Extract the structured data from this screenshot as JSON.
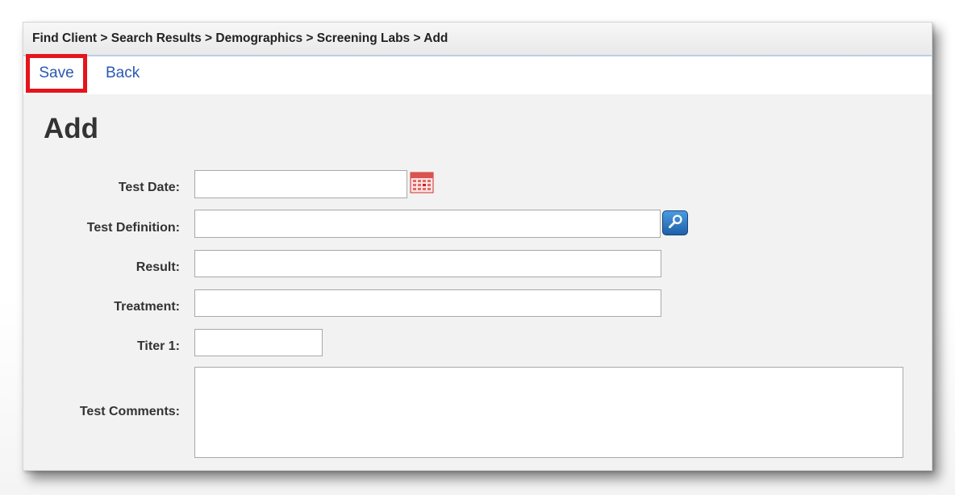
{
  "breadcrumb": {
    "text": "Find Client > Search Results > Demographics > Screening Labs > Add"
  },
  "toolbar": {
    "save_label": "Save",
    "back_label": "Back",
    "highlight_color": "#e5141b"
  },
  "page": {
    "title": "Add"
  },
  "form": {
    "test_date": {
      "label": "Test Date:",
      "value": "",
      "icon": "calendar-icon"
    },
    "test_definition": {
      "label": "Test Definition:",
      "value": "",
      "icon": "lookup-search-icon"
    },
    "result": {
      "label": "Result:",
      "value": ""
    },
    "treatment": {
      "label": "Treatment:",
      "value": ""
    },
    "titer_1": {
      "label": "Titer 1:",
      "value": ""
    },
    "test_comments": {
      "label": "Test Comments:",
      "value": ""
    }
  },
  "colors": {
    "link": "#2b58b2",
    "breadcrumb_border": "#b9cfe6",
    "panel_background": "#f2f2f2"
  }
}
